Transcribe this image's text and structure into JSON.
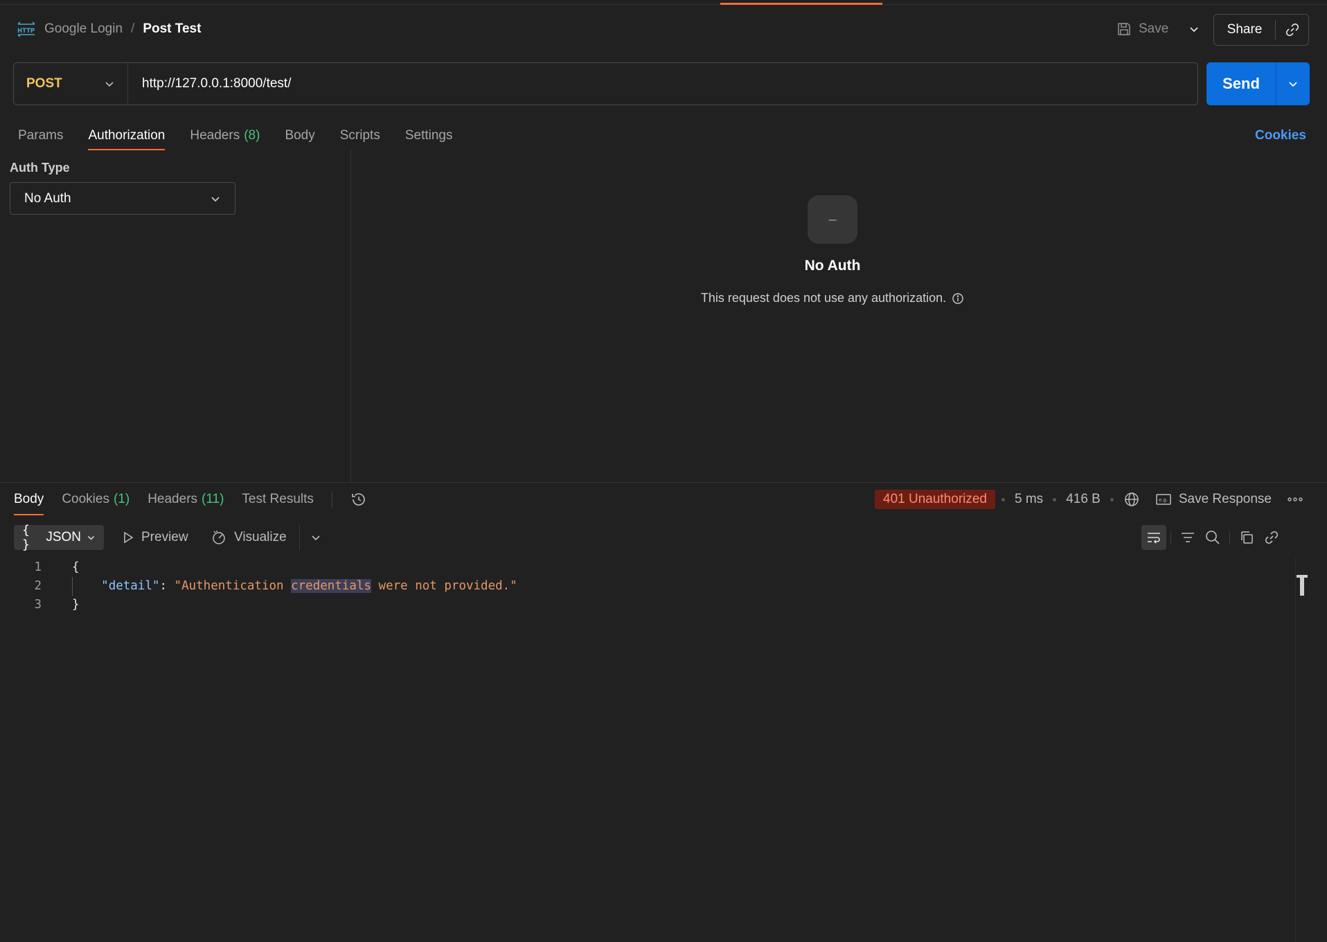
{
  "header": {
    "icon": "http-icon",
    "breadcrumb_parent": "Google Login",
    "breadcrumb_separator": "/",
    "breadcrumb_current": "Post Test",
    "save_label": "Save",
    "share_label": "Share"
  },
  "request": {
    "method": "POST",
    "url": "http://127.0.0.1:8000/test/",
    "send_label": "Send",
    "tabs": [
      {
        "label": "Params"
      },
      {
        "label": "Authorization",
        "active": true
      },
      {
        "label": "Headers",
        "count": "(8)"
      },
      {
        "label": "Body"
      },
      {
        "label": "Scripts"
      },
      {
        "label": "Settings"
      }
    ],
    "cookies_label": "Cookies"
  },
  "auth": {
    "type_label": "Auth Type",
    "selected": "No Auth",
    "empty_icon_text": "–",
    "empty_title": "No Auth",
    "empty_desc": "This request does not use any authorization."
  },
  "response": {
    "tabs": [
      {
        "label": "Body",
        "active": true
      },
      {
        "label": "Cookies",
        "count": "(1)"
      },
      {
        "label": "Headers",
        "count": "(11)"
      },
      {
        "label": "Test Results"
      }
    ],
    "status": "401 Unauthorized",
    "time": "5 ms",
    "size": "416 B",
    "save_response_label": "Save Response",
    "format": "JSON",
    "preview_label": "Preview",
    "visualize_label": "Visualize",
    "code": {
      "line_numbers": [
        "1",
        "2",
        "3"
      ],
      "open_brace": "{",
      "key": "\"detail\"",
      "colon": ": ",
      "value_pre": "\"Authentication ",
      "value_highlight": "credentials",
      "value_post": " were not provided.\"",
      "close_brace": "}"
    }
  },
  "colors": {
    "accent": "#ff6c37",
    "send": "#0d6ede",
    "method": "#f2c45d",
    "status_bg": "#6b1e14",
    "count": "#45c47a",
    "link": "#4d9af7"
  }
}
